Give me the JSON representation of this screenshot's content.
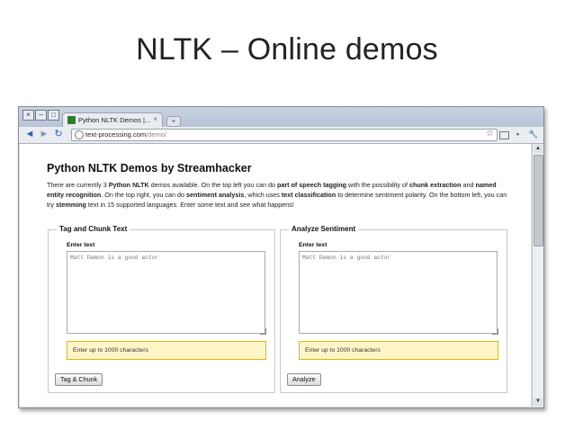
{
  "slide": {
    "title": "NLTK – Online demos"
  },
  "browser": {
    "window_controls": [
      "×",
      "–",
      "□"
    ],
    "tab": {
      "label": "Python NLTK Demos |...",
      "close": "×"
    },
    "new_tab": "+",
    "url": {
      "host": "text-processing.com",
      "path": "/demo/"
    },
    "nav": {
      "back": "◄",
      "forward": "►",
      "reload": "↻"
    },
    "star": "☆"
  },
  "page": {
    "heading": "Python NLTK Demos by Streamhacker",
    "intro": [
      "There are currently 3 ",
      "Python NLTK",
      " demos available. On the top left you can do ",
      "part of speech tagging",
      " with the possibility of ",
      "chunk extraction",
      " and ",
      "named entity recognition",
      ". On the top right, you can do ",
      "sentiment analysis",
      ", which uses ",
      "text classification",
      " to determine sentiment polarity. On the bottom left, you can try ",
      "stemming",
      " text in 15 supported languages. Enter some text and see what happens!"
    ],
    "left_panel": {
      "legend": "Tag and Chunk Text",
      "label": "Enter text",
      "placeholder": "Matt Damon is a good actor",
      "hint": "Enter up to 1000 characters",
      "button": "Tag & Chunk"
    },
    "right_panel": {
      "legend": "Analyze Sentiment",
      "label": "Enter text",
      "placeholder": "Matt Damon is a good actor",
      "hint": "Enter up to 1000 characters",
      "button": "Analyze"
    }
  }
}
